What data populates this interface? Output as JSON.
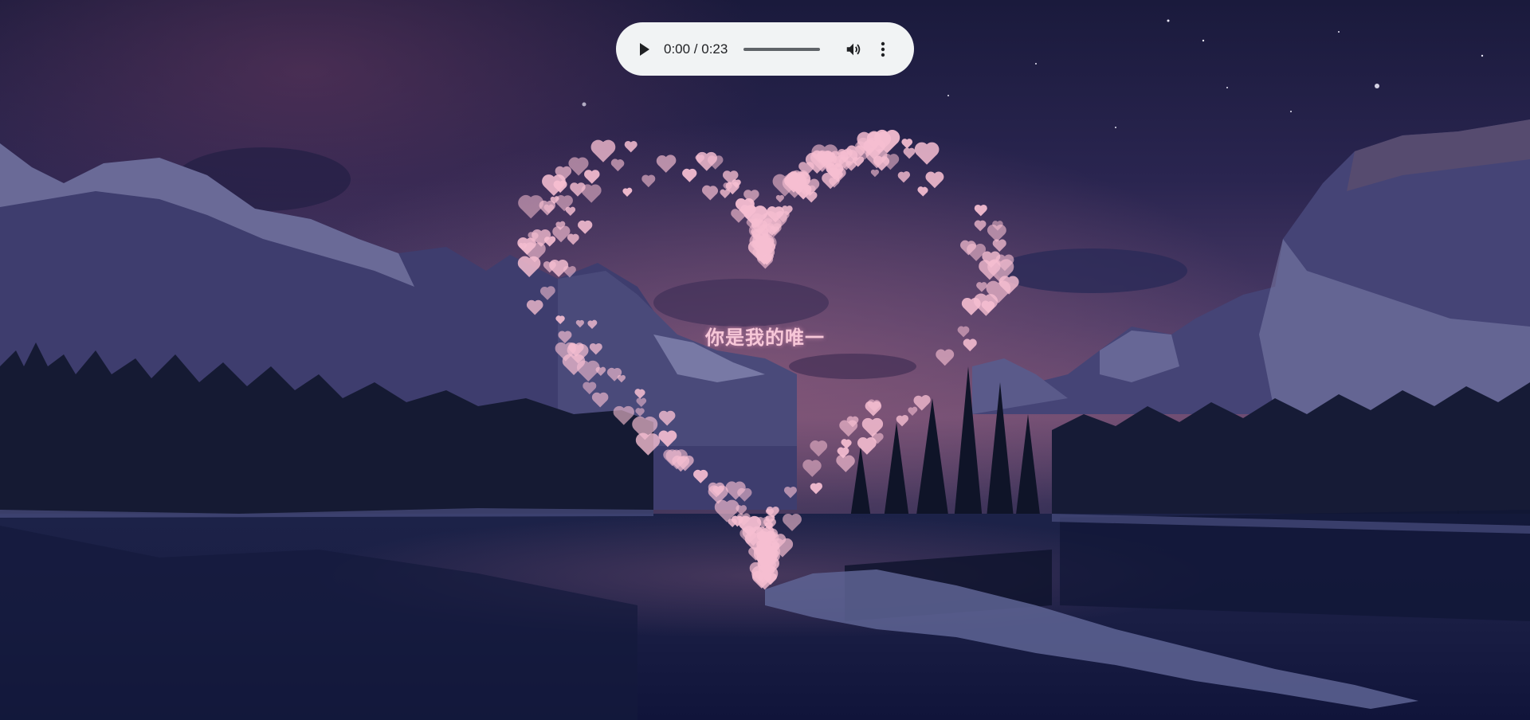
{
  "audio": {
    "time_text": "0:00 / 0:23",
    "progress": 0,
    "icons": {
      "play": "play-icon",
      "volume": "volume-icon",
      "more": "more-options-icon"
    }
  },
  "message": {
    "text": "你是我的唯一"
  },
  "colors": {
    "heart_pink": "#f7bfd2",
    "sky_top": "#1c1b3d",
    "sky_glow": "#6a4470",
    "water": "#141a3a",
    "player_bg": "#f1f3f4"
  }
}
